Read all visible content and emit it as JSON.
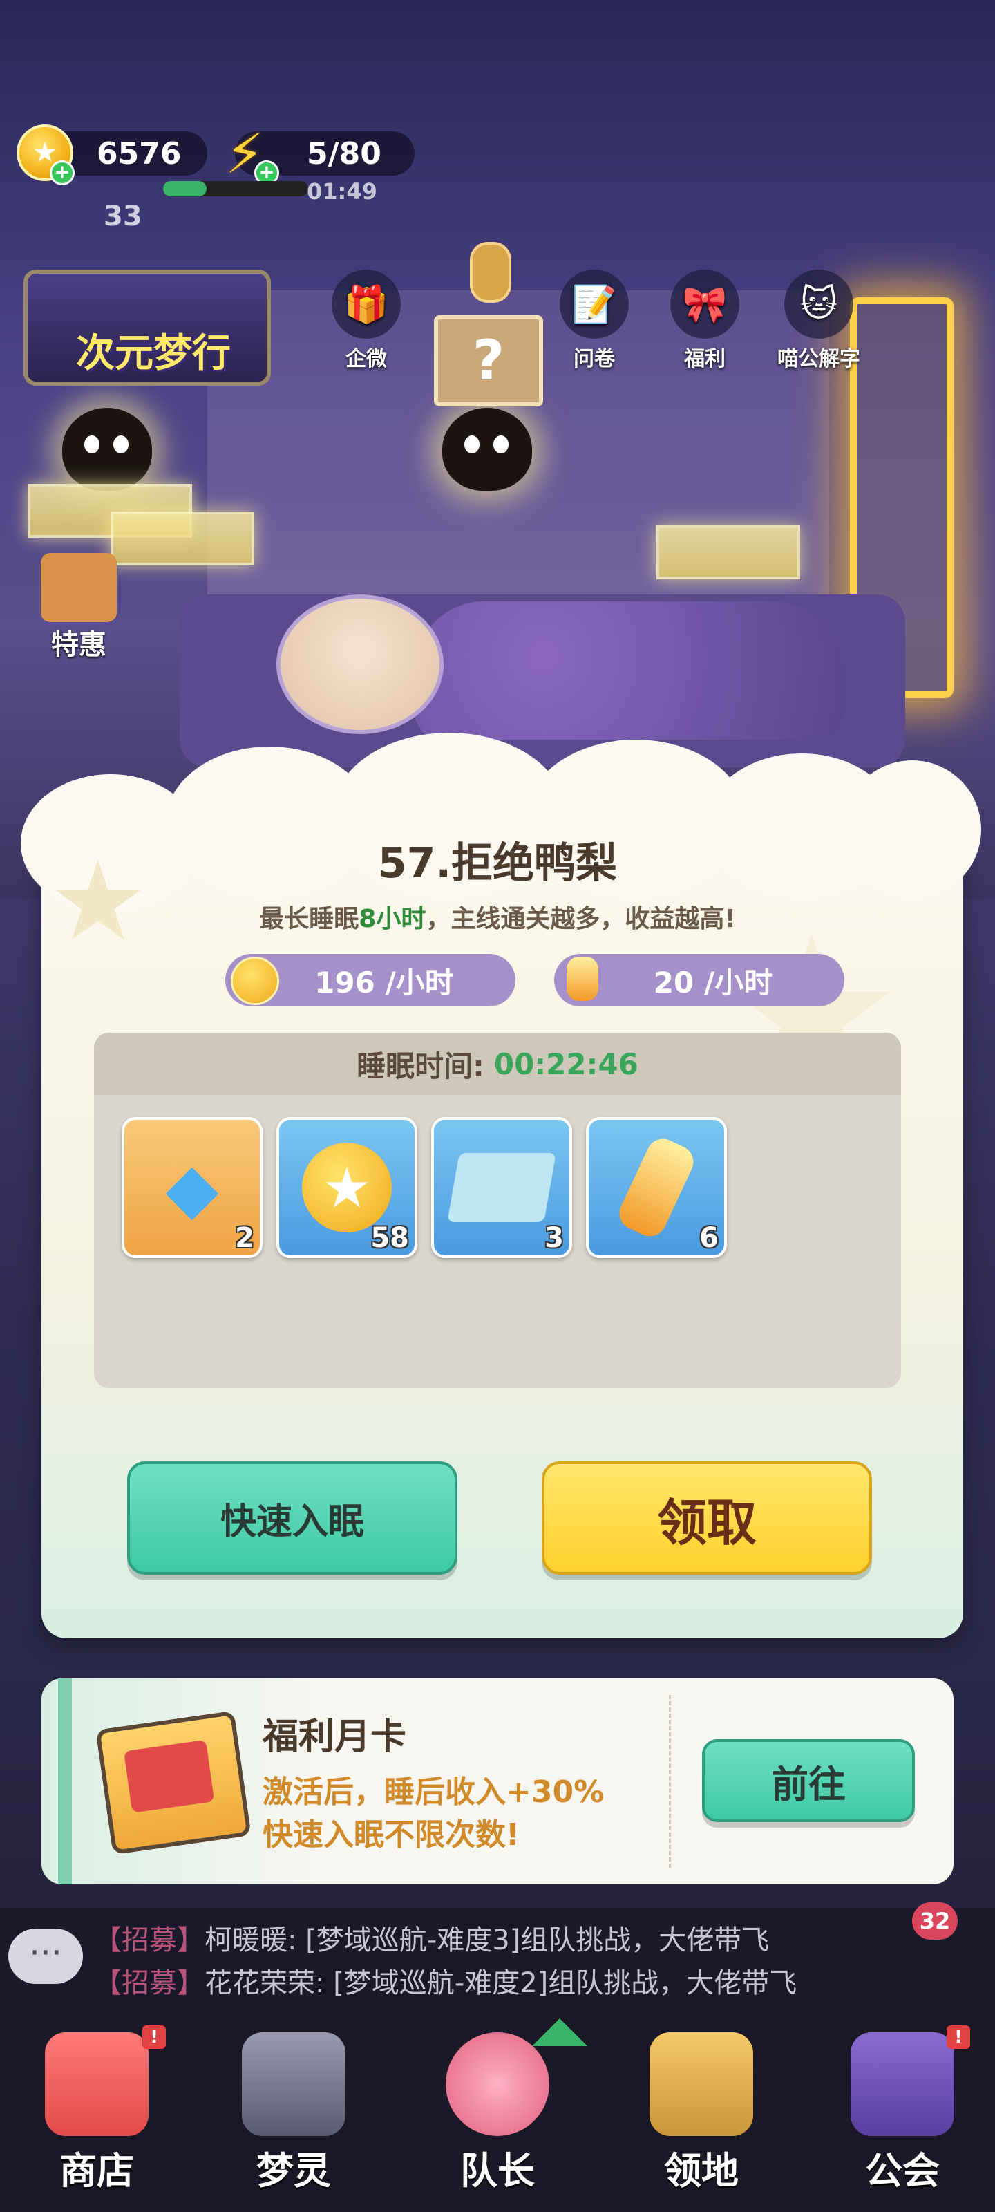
{
  "hud": {
    "coins": "6576",
    "energy": "5/80",
    "energy_timer": "01:49",
    "player_level": "33"
  },
  "top_menu": {
    "event_banner": "次元梦行",
    "items": [
      {
        "label": "企微",
        "icon": "gift-icon"
      },
      {
        "label": "问卷",
        "icon": "survey-icon"
      },
      {
        "label": "福利",
        "icon": "welfare-icon"
      },
      {
        "label": "喵公解字",
        "icon": "cat-icon"
      }
    ],
    "left_side_label": "特惠"
  },
  "sleep_card": {
    "title": "57.拒绝鸭梨",
    "subtitle_prefix": "最长睡眠",
    "subtitle_highlight": "8小时",
    "subtitle_suffix": "，主线通关越多，收益越高!",
    "rate_coins": "196 /小时",
    "rate_potion": "20 /小时",
    "sleep_time_label": "睡眠时间:",
    "sleep_time_value": "00:22:46",
    "rewards": [
      {
        "icon": "diamond-icon",
        "count": "2"
      },
      {
        "icon": "coin-icon",
        "count": "58"
      },
      {
        "icon": "map-icon",
        "count": "3"
      },
      {
        "icon": "potion-icon",
        "count": "6"
      }
    ],
    "quick_sleep_label": "快速入眠",
    "claim_label": "领取"
  },
  "monthly_card": {
    "title": "福利月卡",
    "desc_line1": "激活后，睡后收入+30%",
    "desc_line2": "快速入眠不限次数!",
    "go_label": "前往"
  },
  "chat": {
    "unread": "32",
    "lines": [
      {
        "tag": "【招募】",
        "text": "柯暖暖: [梦域巡航-难度3]组队挑战，大佬带飞"
      },
      {
        "tag": "【招募】",
        "text": "花花荣荣: [梦域巡航-难度2]组队挑战，大佬带飞"
      }
    ]
  },
  "bottom_nav": [
    {
      "label": "商店",
      "icon": "shop-icon",
      "badge": "!"
    },
    {
      "label": "梦灵",
      "icon": "spirit-icon",
      "badge": ""
    },
    {
      "label": "队长",
      "icon": "captain-icon",
      "badge": ""
    },
    {
      "label": "领地",
      "icon": "territory-icon",
      "badge": ""
    },
    {
      "label": "公会",
      "icon": "guild-icon",
      "badge": "!"
    }
  ],
  "colors": {
    "accent_green": "#2e8b3a",
    "time_green": "#3aa55a",
    "teal_button": "#4fd3b0",
    "yellow_button": "#ffd84a",
    "rate_purple": "#a690c9"
  }
}
